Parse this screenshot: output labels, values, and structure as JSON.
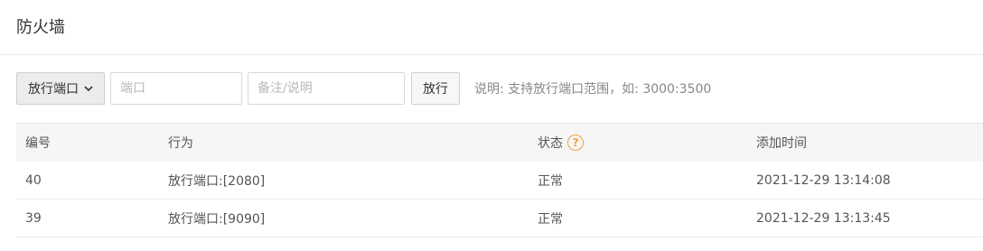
{
  "page": {
    "title": "防火墙"
  },
  "toolbar": {
    "mode_select": {
      "selected": "放行端口"
    },
    "port_input": {
      "placeholder": "端口",
      "value": ""
    },
    "note_input": {
      "placeholder": "备注/说明",
      "value": ""
    },
    "submit_label": "放行",
    "hint": "说明: 支持放行端口范围，如: 3000:3500"
  },
  "table": {
    "columns": [
      "编号",
      "行为",
      "状态",
      "添加时间"
    ],
    "status_help_icon": "question-circle-icon",
    "rows": [
      {
        "id": "40",
        "action": "放行端口:[2080]",
        "status": "正常",
        "added": "2021-12-29 13:14:08"
      },
      {
        "id": "39",
        "action": "放行端口:[9090]",
        "status": "正常",
        "added": "2021-12-29 13:13:45"
      }
    ]
  },
  "colors": {
    "help_icon": "#f0a040",
    "header_bg": "#f6f6f6"
  }
}
